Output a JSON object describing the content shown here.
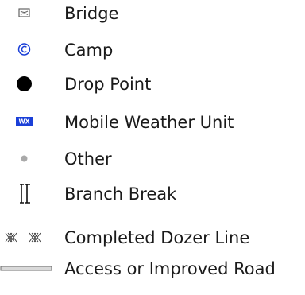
{
  "legend": {
    "items": [
      {
        "label": "Bridge",
        "icon": "bridge-icon"
      },
      {
        "label": "Camp",
        "icon": "camp-icon"
      },
      {
        "label": "Drop Point",
        "icon": "drop-point-icon"
      },
      {
        "label": "Mobile Weather Unit",
        "icon": "mobile-weather-unit-icon",
        "icon_text": "WX"
      },
      {
        "label": "Other",
        "icon": "other-dot-icon"
      },
      {
        "label": "Branch Break",
        "icon": "branch-break-icon"
      },
      {
        "label": "Completed Dozer Line",
        "icon": "completed-dozer-line-icon"
      },
      {
        "label": "Access or Improved Road",
        "icon": "access-road-icon"
      }
    ]
  },
  "colors": {
    "text": "#1a1a1a",
    "accent_blue": "#1a3fd8",
    "other_dot": "#a9a9a9",
    "road_fill": "#d9d9d9",
    "road_edge": "#6b6b6b"
  }
}
